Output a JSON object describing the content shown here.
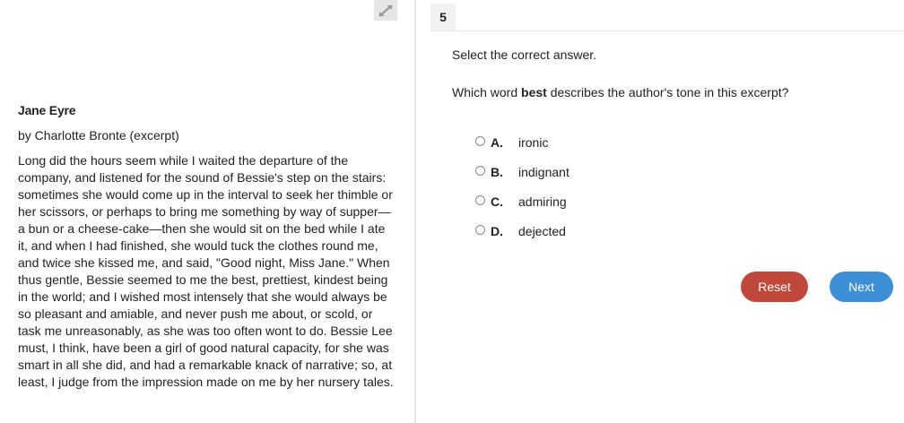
{
  "passage": {
    "title": "Jane Eyre",
    "byline": "by Charlotte Bronte (excerpt)",
    "body": "Long did the hours seem while I waited the departure of the company, and listened for the sound of Bessie's step on the stairs: sometimes she would come up in the interval to seek her thimble or her scissors, or perhaps to bring me something by way of supper—a bun or a cheese-cake—then she would sit on the bed while I ate it, and when I had finished, she would tuck the clothes round me, and twice she kissed me, and said, \"Good night, Miss Jane.\" When thus gentle, Bessie seemed to me the best, prettiest, kindest being in the world; and I wished most intensely that she would always be so pleasant and amiable, and never push me about, or scold, or task me unreasonably, as she was too often wont to do. Bessie Lee must, I think, have been a girl of good natural capacity, for she was smart in all she did, and had a remarkable knack of narrative; so, at least, I judge from the impression made on me by her nursery tales."
  },
  "question": {
    "number": "5",
    "instruction": "Select the correct answer.",
    "prompt_before": "Which word ",
    "prompt_bold": "best",
    "prompt_after": " describes the author's tone in this excerpt?",
    "options": [
      {
        "letter": "A.",
        "text": "ironic"
      },
      {
        "letter": "B.",
        "text": "indignant"
      },
      {
        "letter": "C.",
        "text": "admiring"
      },
      {
        "letter": "D.",
        "text": "dejected"
      }
    ]
  },
  "buttons": {
    "reset": "Reset",
    "next": "Next"
  },
  "icons": {
    "expand": "expand-arrows-icon"
  },
  "colors": {
    "reset": "#c0483a",
    "next": "#3d8fd8"
  }
}
